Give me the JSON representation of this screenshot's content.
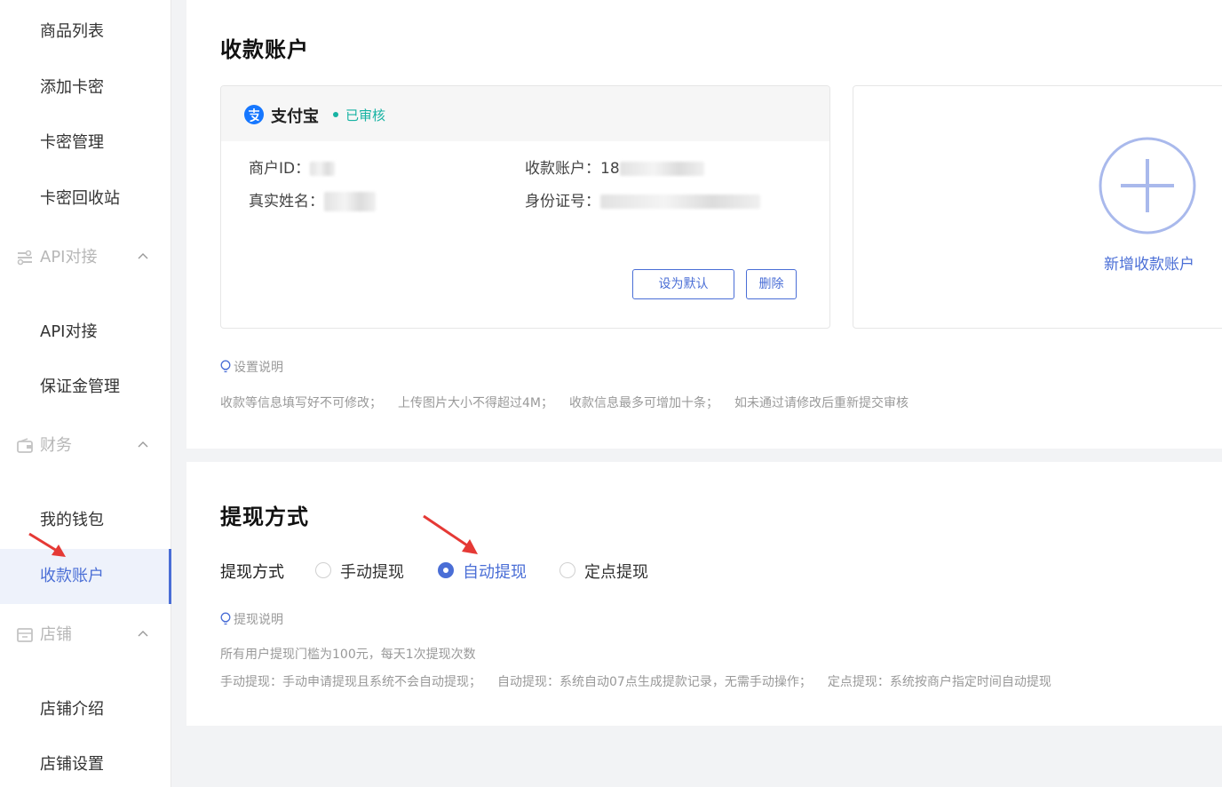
{
  "sidebar": {
    "items": [
      {
        "label": "商品列表"
      },
      {
        "label": "添加卡密"
      },
      {
        "label": "卡密管理"
      },
      {
        "label": "卡密回收站"
      },
      {
        "label": "API对接"
      },
      {
        "label": "保证金管理"
      },
      {
        "label": "我的钱包"
      },
      {
        "label": "收款账户"
      },
      {
        "label": "店铺介绍"
      },
      {
        "label": "店铺设置"
      }
    ],
    "groups": [
      {
        "label": "API对接",
        "icon": "api-icon"
      },
      {
        "label": "财务",
        "icon": "wallet-icon"
      },
      {
        "label": "店铺",
        "icon": "store-icon"
      }
    ]
  },
  "account": {
    "title": "收款账户",
    "card": {
      "provider": "支付宝",
      "status": "已审核",
      "merchant_id_label": "商户ID：",
      "merchant_id_value": "93",
      "account_label": "收款账户：",
      "account_value": "18",
      "name_label": "真实姓名：",
      "id_label": "身份证号：",
      "id_value": "5102342000",
      "set_default": "设为默认",
      "delete": "删除"
    },
    "add_label": "新增收款账户",
    "tip_title": "设置说明",
    "tips": [
      "收款等信息填写好不可修改；",
      "上传图片大小不得超过4M；",
      "收款信息最多可增加十条；",
      "如未通过请修改后重新提交审核"
    ]
  },
  "withdraw": {
    "title": "提现方式",
    "label": "提现方式",
    "options": [
      {
        "label": "手动提现",
        "selected": false
      },
      {
        "label": "自动提现",
        "selected": true
      },
      {
        "label": "定点提现",
        "selected": false
      }
    ],
    "tip_title": "提现说明",
    "line1": "所有用户提现门槛为100元，每天1次提现次数",
    "line2": [
      "手动提现：手动申请提现且系统不会自动提现；",
      "自动提现：系统自动07点生成提款记录，无需手动操作；",
      "定点提现：系统按商户指定时间自动提现"
    ]
  },
  "colors": {
    "accent": "#4a6ed6",
    "status": "#17b3a3",
    "arrow": "#e53935"
  }
}
